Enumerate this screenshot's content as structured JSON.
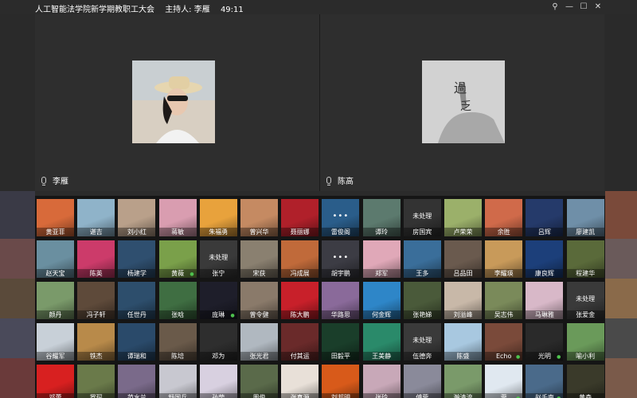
{
  "meeting": {
    "title": "人工智能法学院新学期教职工大会",
    "host": "主持人: 李雁",
    "timer": "49:11"
  },
  "window_buttons": [
    {
      "name": "pin-icon",
      "glyph": "⚲"
    },
    {
      "name": "minimize-icon",
      "glyph": "—"
    },
    {
      "name": "maximize-icon",
      "glyph": "☐"
    },
    {
      "name": "close-icon",
      "glyph": "✕"
    }
  ],
  "speakers": [
    {
      "name": "李雁"
    },
    {
      "name": "陈高"
    }
  ],
  "colors": {
    "background": "#2b2b2b",
    "grid_bg": "#151515",
    "speaking": "#4ec24e"
  },
  "participants": [
    {
      "label": "黄亚菲",
      "bg": "#d86a3a"
    },
    {
      "label": "谌吉",
      "bg": "#8fb3c9"
    },
    {
      "label": "刘小红",
      "bg": "#b9a08a"
    },
    {
      "label": "蒋敏",
      "bg": "#d99db0"
    },
    {
      "label": "朱福勇",
      "bg": "#e8a23c"
    },
    {
      "label": "曾兴华",
      "bg": "#c58a62"
    },
    {
      "label": "聂丽娜",
      "bg": "#b0202a"
    },
    {
      "label": "雷俊阁",
      "bg": "#2a5d8a",
      "dots": true
    },
    {
      "label": "谭玲",
      "bg": "#5c7a6e"
    },
    {
      "label": "房国宾",
      "bg": "#333333",
      "placeholder": "未处理"
    },
    {
      "label": "卢荣荣",
      "bg": "#9bb06a"
    },
    {
      "label": "余胜",
      "bg": "#d06a4a"
    },
    {
      "label": "吕辉",
      "bg": "#253a6a"
    },
    {
      "label": "廖建凯",
      "bg": "#6f8fa8"
    },
    {
      "label": "赵天宝",
      "bg": "#6a8fa0"
    },
    {
      "label": "陈英",
      "bg": "#cc3b6a"
    },
    {
      "label": "杨建学",
      "bg": "#2f4f6f"
    },
    {
      "label": "黄薇",
      "bg": "#7aa04a",
      "speaking": true
    },
    {
      "label": "张宁",
      "bg": "#3a3a3a",
      "placeholder": "未处理"
    },
    {
      "label": "宋获",
      "bg": "#8a8070"
    },
    {
      "label": "冯成展",
      "bg": "#c06a3a"
    },
    {
      "label": "胡宇鹏",
      "bg": "#3c3c44",
      "dots": true
    },
    {
      "label": "郑军",
      "bg": "#e0a8b8"
    },
    {
      "label": "王多",
      "bg": "#3a6e9a"
    },
    {
      "label": "吕品田",
      "bg": "#6a5a4e"
    },
    {
      "label": "李耀瑛",
      "bg": "#c89a5a"
    },
    {
      "label": "康良辉",
      "bg": "#1c3f7a"
    },
    {
      "label": "程建华",
      "bg": "#5a6a3a"
    },
    {
      "label": "颜丹",
      "bg": "#7a9a6a"
    },
    {
      "label": "冯子轩",
      "bg": "#5e4a3a"
    },
    {
      "label": "任世丹",
      "bg": "#2d4e6c"
    },
    {
      "label": "张晗",
      "bg": "#3f6e42"
    },
    {
      "label": "庞琳",
      "bg": "#1e1e2a",
      "speaking": true
    },
    {
      "label": "曾令健",
      "bg": "#8a7a6a"
    },
    {
      "label": "陈大鹏",
      "bg": "#c8202a"
    },
    {
      "label": "华路思",
      "bg": "#8a6a9a"
    },
    {
      "label": "何金辉",
      "bg": "#2e86c8"
    },
    {
      "label": "张艳娣",
      "bg": "#4a5a3a"
    },
    {
      "label": "刘溢峰",
      "bg": "#c8b8a8"
    },
    {
      "label": "吴志伟",
      "bg": "#7a8a5a"
    },
    {
      "label": "马琳雅",
      "bg": "#d8b8c8"
    },
    {
      "label": "张爱金",
      "bg": "#3a3a3a",
      "placeholder": "未处理"
    },
    {
      "label": "谷耀军",
      "bg": "#c8d0d8"
    },
    {
      "label": "铁杰",
      "bg": "#b88a4a"
    },
    {
      "label": "谭瑞和",
      "bg": "#2a4a6a"
    },
    {
      "label": "陈培",
      "bg": "#6a5a4a"
    },
    {
      "label": "邓为",
      "bg": "#2e2e2e"
    },
    {
      "label": "张光君",
      "bg": "#b0b8c0"
    },
    {
      "label": "付其运",
      "bg": "#6a2a2a"
    },
    {
      "label": "田毅平",
      "bg": "#1a3e2a"
    },
    {
      "label": "王美静",
      "bg": "#2a8a6a"
    },
    {
      "label": "伍德奔",
      "bg": "#3a3a3a",
      "placeholder": "未处理"
    },
    {
      "label": "陈盛",
      "bg": "#a8c8e0"
    },
    {
      "label": "Echo",
      "bg": "#7a4a3a",
      "speaking": true
    },
    {
      "label": "光明",
      "bg": "#2a2a2a",
      "speaking": true
    },
    {
      "label": "喻小利",
      "bg": "#6a9a5a"
    },
    {
      "label": "邓蕾",
      "bg": "#d82020"
    },
    {
      "label": "罗琛",
      "bg": "#6a7a4a"
    },
    {
      "label": "范水兰",
      "bg": "#7a6a8a"
    },
    {
      "label": "舒国兵",
      "bg": "#c8c8d0"
    },
    {
      "label": "孙莹",
      "bg": "#d8d0e0"
    },
    {
      "label": "周俊",
      "bg": "#5a6a4a"
    },
    {
      "label": "张真源",
      "bg": "#e8e0d8"
    },
    {
      "label": "刘邦明",
      "bg": "#d85a1a"
    },
    {
      "label": "张玲",
      "bg": "#c8a8b8"
    },
    {
      "label": "傅蓉",
      "bg": "#8a8a9a"
    },
    {
      "label": "瀚清流",
      "bg": "#7a9a6a"
    },
    {
      "label": "蓉",
      "bg": "#e0e8f0",
      "speaking": true
    },
    {
      "label": "赵千南",
      "bg": "#4a6a8a",
      "speaking": true
    },
    {
      "label": "黄森",
      "bg": "#3a3a2a"
    }
  ]
}
